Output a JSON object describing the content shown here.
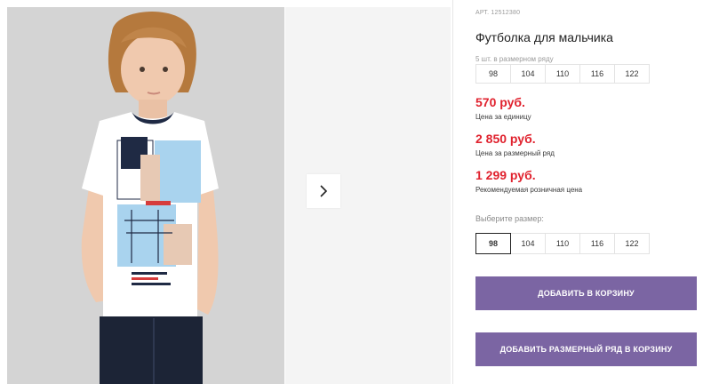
{
  "gallery": {
    "photo_alt": "boy-tshirt-photo",
    "next_icon": "chevron-right-icon"
  },
  "product": {
    "article": "АРТ. 12512380",
    "title": "Футболка для мальчика"
  },
  "size_set": {
    "label": "5 шт. в размерном ряду",
    "sizes": [
      "98",
      "104",
      "110",
      "116",
      "122"
    ]
  },
  "prices": {
    "unit_price": "570 руб.",
    "unit_note": "Цена за единицу",
    "set_price": "2 850 руб.",
    "set_note": "Цена за размерный ряд",
    "retail_price": "1 299 руб.",
    "retail_note": "Рекомендуемая розничная цена"
  },
  "size_picker": {
    "label": "Выберите размер:",
    "sizes": [
      "98",
      "104",
      "110",
      "116",
      "122"
    ],
    "selected": "98"
  },
  "actions": {
    "add_to_cart": "ДОБАВИТЬ В КОРЗИНУ",
    "add_set_to_cart": "ДОБАВИТЬ РАЗМЕРНЫЙ РЯД В КОРЗИНУ"
  },
  "colors": {
    "accent_button": "#7b65a3",
    "price_red": "#e0222e"
  }
}
